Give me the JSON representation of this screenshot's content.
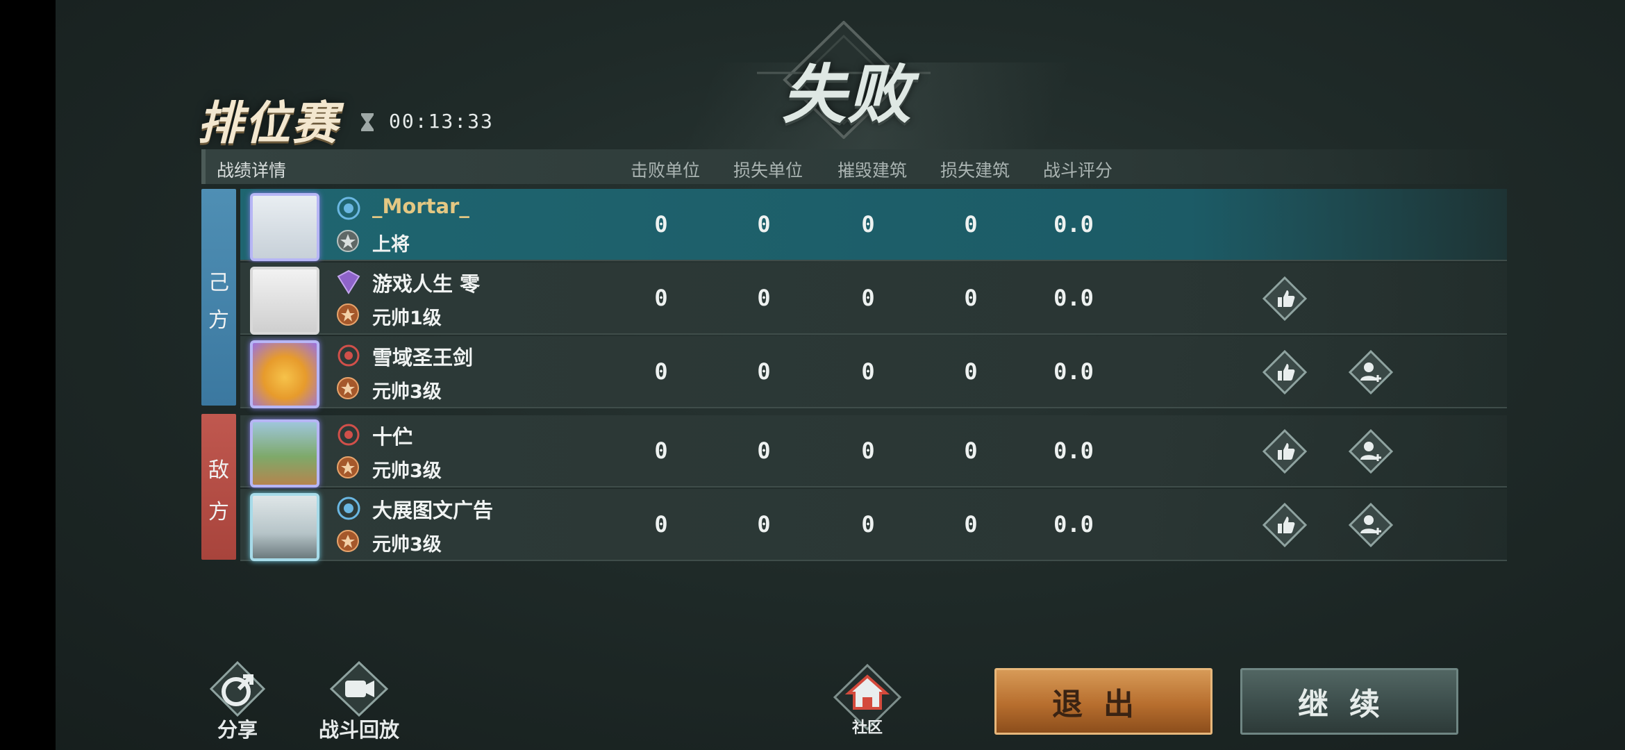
{
  "header": {
    "mode_title": "排位赛",
    "timer": "00:13:33",
    "result": "失败"
  },
  "table": {
    "title": "战绩详情",
    "columns": [
      "击败单位",
      "损失单位",
      "摧毁建筑",
      "损失建筑",
      "战斗评分"
    ]
  },
  "teams": {
    "mine_label": [
      "己",
      "方"
    ],
    "enemy_label": [
      "敌",
      "方"
    ]
  },
  "players": [
    {
      "name": "_Mortar_",
      "rank": "上将",
      "stats": [
        "0",
        "0",
        "0",
        "0",
        "0.0"
      ],
      "self": true
    },
    {
      "name": "游戏人生 零",
      "rank": "元帅1级",
      "stats": [
        "0",
        "0",
        "0",
        "0",
        "0.0"
      ]
    },
    {
      "name": "雪域圣王剑",
      "rank": "元帅3级",
      "stats": [
        "0",
        "0",
        "0",
        "0",
        "0.0"
      ]
    },
    {
      "name": "十伫",
      "rank": "元帅3级",
      "stats": [
        "0",
        "0",
        "0",
        "0",
        "0.0"
      ]
    },
    {
      "name": "大展图文广告",
      "rank": "元帅3级",
      "stats": [
        "0",
        "0",
        "0",
        "0",
        "0.0"
      ]
    }
  ],
  "bottom": {
    "share_label": "分享",
    "replay_label": "战斗回放",
    "community_label": "社区",
    "exit_label": "退出",
    "continue_label": "继续"
  },
  "icons": {
    "like": "thumbs-up-icon",
    "add_friend": "add-friend-icon",
    "share": "share-icon",
    "replay": "video-camera-icon",
    "community": "home-icon"
  },
  "colors": {
    "mine_team": "#3b78a0",
    "enemy_team": "#a8443c",
    "self_row": "#1f6570",
    "exit": "#b76e2e"
  }
}
